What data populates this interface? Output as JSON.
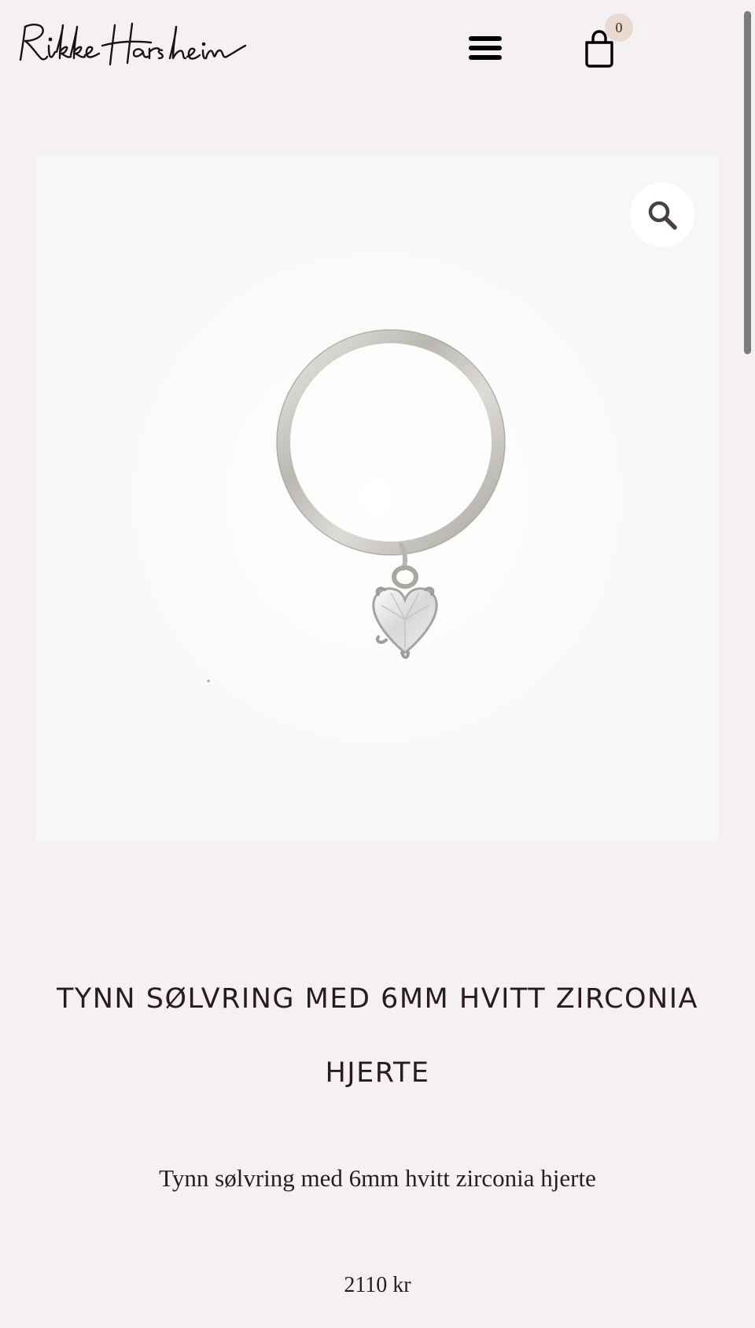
{
  "header": {
    "logo_text": "Rikke Harsheim",
    "menu_icon": "hamburger-menu-icon",
    "cart_icon": "shopping-bag-icon",
    "cart_count": "0"
  },
  "product": {
    "image_alt": "Tynn sølvring med 6mm hvitt zirconia hjerte",
    "zoom_icon": "magnifier-icon",
    "title_line1": "TYNN SØLVRING MED 6MM HVITT ZIRCONIA",
    "title_line2": "HJERTE",
    "description": "Tynn sølvring med 6mm hvitt zirconia hjerte",
    "price": "2110 kr"
  },
  "colors": {
    "background": "#f5f1f2",
    "text": "#2b1a1f",
    "cart_badge": "#ead9cf",
    "image_background": "#ffffff"
  }
}
